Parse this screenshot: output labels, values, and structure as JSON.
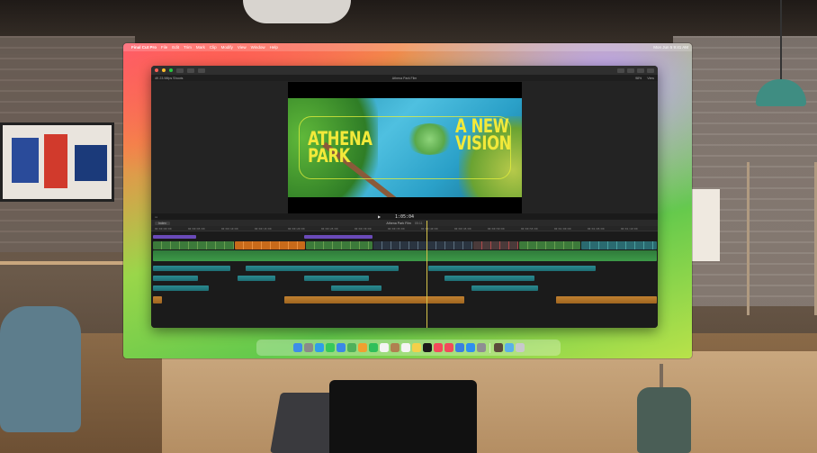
{
  "menubar": {
    "app_name": "Final Cut Pro",
    "items": [
      "File",
      "Edit",
      "Trim",
      "Mark",
      "Clip",
      "Modify",
      "View",
      "Window",
      "Help"
    ],
    "clock": "Mon Jun 5  9:41 AM"
  },
  "window": {
    "library": "4K 23.98fps Shoots",
    "project_title": "Athena Park Film",
    "zoom": "98%",
    "view_menu": "View",
    "video_frame": {
      "title_left": [
        "ATHENA",
        "PARK"
      ],
      "title_right": [
        "A NEW",
        "VISION"
      ]
    },
    "timecode": "1:05:04",
    "timeline": {
      "index_label": "Index",
      "project_tab": "Athena Park Film",
      "duration": "05:11",
      "ruler": [
        "00:00:00:00",
        "00:00:05:00",
        "00:00:10:00",
        "00:00:15:00",
        "00:00:20:00",
        "00:00:25:00",
        "00:00:30:00",
        "00:00:35:00",
        "00:00:40:00",
        "00:00:45:00",
        "00:00:50:00",
        "00:00:55:00",
        "00:01:00:00",
        "00:01:05:00",
        "00:01:10:00"
      ]
    }
  },
  "dock": {
    "icons": [
      "finder-icon",
      "launchpad-icon",
      "safari-icon",
      "messages-icon",
      "mail-icon",
      "maps-icon",
      "photos-icon",
      "facetime-icon",
      "calendar-icon",
      "contacts-icon",
      "reminders-icon",
      "notes-icon",
      "appletv-icon",
      "music-icon",
      "news-icon",
      "keynote-icon",
      "appstore-icon",
      "settings-icon",
      "finalcut-icon",
      "folder-icon",
      "trash-icon"
    ],
    "colors": [
      "#3d8de8",
      "#8a8a8a",
      "#2f9ee8",
      "#37c95a",
      "#3b87e6",
      "#4fb05a",
      "#f0a030",
      "#2fbf5a",
      "#f4f4f4",
      "#b08050",
      "#f4f4f4",
      "#f4d04a",
      "#1a1a1a",
      "#f24a5a",
      "#f24a5a",
      "#3a7fe0",
      "#2f8ff0",
      "#8e8e93",
      "#5b4a3a",
      "#5ab0e8",
      "#c8c8cc"
    ]
  }
}
